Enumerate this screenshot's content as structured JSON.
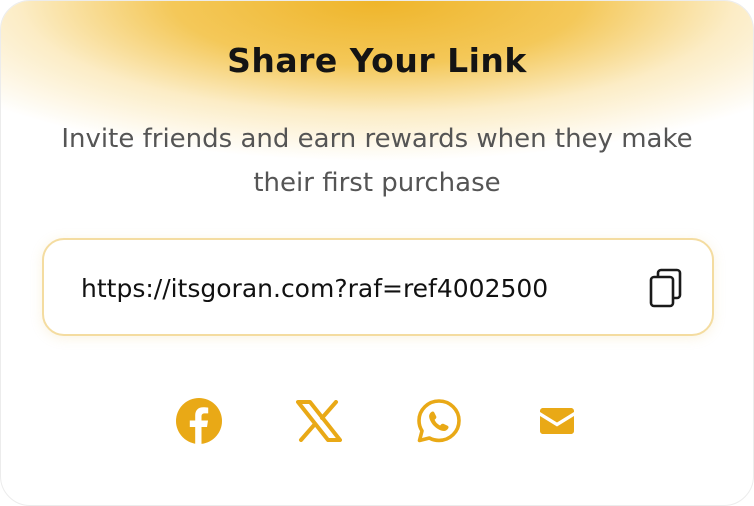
{
  "card": {
    "title": "Share Your Link",
    "subtitle": "Invite friends and earn rewards when they make their first purchase"
  },
  "link": {
    "url": "https://itsgoran.com?raf=ref4002500",
    "copy_icon": "copy-icon"
  },
  "share": {
    "buttons": [
      {
        "name": "facebook",
        "icon": "facebook-icon"
      },
      {
        "name": "x",
        "icon": "x-icon"
      },
      {
        "name": "whatsapp",
        "icon": "whatsapp-icon"
      },
      {
        "name": "email",
        "icon": "email-icon"
      }
    ]
  },
  "colors": {
    "accent": "#e9a916",
    "header_glow": "#f2bc3a",
    "title": "#141414",
    "subtitle": "#555555",
    "link_border": "#f4dca0"
  }
}
